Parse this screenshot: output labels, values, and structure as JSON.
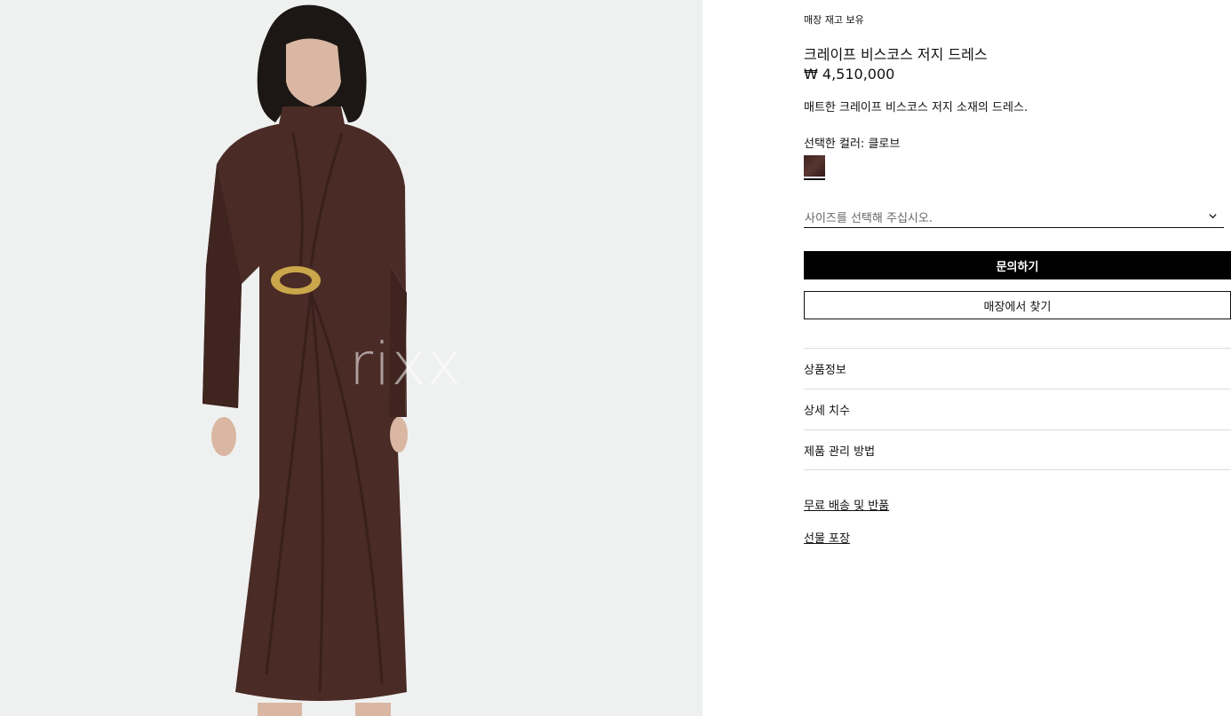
{
  "product_image": {
    "watermark": "rixx",
    "background_color": "#eff1f0",
    "garment_color": "#4a2b26"
  },
  "product": {
    "stock_status": "매장 재고 보유",
    "name": "크레이프 비스코스 저지 드레스",
    "price": "₩ 4,510,000",
    "description": "매트한 크레이프 비스코스 저지 소재의 드레스.",
    "selected_color_label": "선택한 컬러: 클로브",
    "swatch_color": "#3c2320"
  },
  "size_select": {
    "placeholder": "사이즈를 선택해 주십시오.",
    "icon": "chevron-down-icon"
  },
  "actions": {
    "inquire_label": "문의하기",
    "find_store_label": "매장에서 찾기"
  },
  "accordion": {
    "items": [
      {
        "label": "상품정보"
      },
      {
        "label": "상세 치수"
      },
      {
        "label": "제품 관리 방법"
      }
    ]
  },
  "links": {
    "shipping_returns": "무료 배송 및 반품",
    "gift_wrap": "선물 포장"
  }
}
